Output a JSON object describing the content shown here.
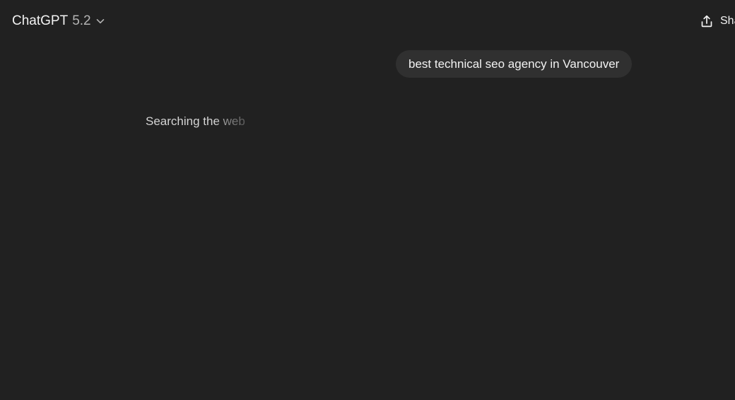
{
  "header": {
    "model_name": "ChatGPT",
    "model_version": "5.2",
    "share_label": "Share"
  },
  "icons": {
    "model_chevron": "chevron-down-icon",
    "share": "share-upload-icon"
  },
  "conversation": {
    "user_message": "best technical seo agency in Vancouver",
    "status_text": "Searching the web"
  },
  "colors": {
    "background": "#212121",
    "bubble": "#303030",
    "text_primary": "#f2f2f2",
    "text_secondary": "#b4b4b4"
  }
}
